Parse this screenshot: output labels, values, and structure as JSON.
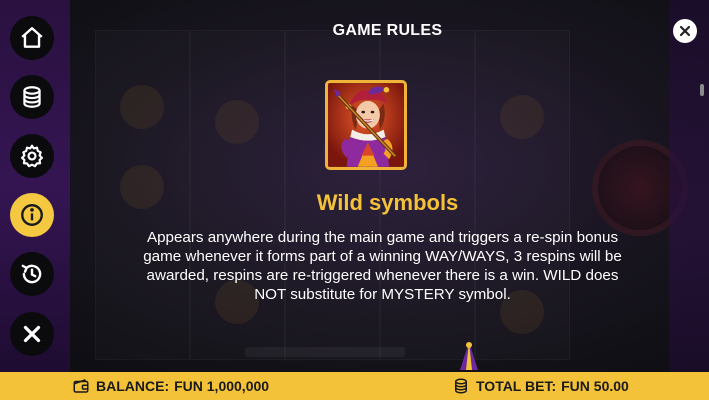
{
  "header": {
    "title": "GAME RULES"
  },
  "menu": {
    "items": [
      {
        "icon": "home-icon",
        "active": false
      },
      {
        "icon": "coin-stack-icon",
        "active": false
      },
      {
        "icon": "gear-icon",
        "active": false
      },
      {
        "icon": "info-icon",
        "active": true
      },
      {
        "icon": "history-icon",
        "active": false
      },
      {
        "icon": "close-icon",
        "active": false
      }
    ]
  },
  "section": {
    "heading": "Wild symbols",
    "description": "Appears anywhere during the main game and triggers a re-spin bonus game whenever it forms part of a winning WAY/WAYS, 3 respins will be awarded, respins are re-triggered whenever there is a win. WILD does NOT substitute for MYSTERY symbol.",
    "symbol": "wild-jester-symbol"
  },
  "footer": {
    "balance_label": "BALANCE:",
    "balance_value": "FUN 1,000,000",
    "bet_label": "TOTAL BET:",
    "bet_value": "FUN 50.00"
  },
  "colors": {
    "accent": "#f4c238",
    "menu_button": "#0b0b0e",
    "card_frame": "#f0b43a"
  }
}
